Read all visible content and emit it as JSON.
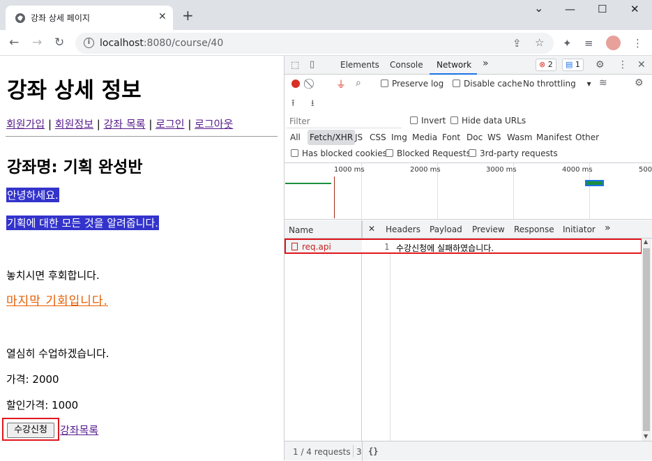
{
  "browser": {
    "tab_title": "강좌 상세 페이지",
    "tab_close": "✕",
    "new_tab": "+",
    "url_host": "localhost",
    "url_rest": ":8080/course/40",
    "win_min": "⌄",
    "win_minimize": "—",
    "win_max": "☐",
    "win_close": "✕"
  },
  "page": {
    "heading": "강좌 상세 정보",
    "nav": [
      "회원가입",
      "회원정보",
      "강좌 목록",
      "로그인",
      "로그아웃"
    ],
    "nav_sep": " | ",
    "course_title": "강좌명: 기획 완성반",
    "highlight1": "안녕하세요.",
    "highlight2": "기획에 대한 모든 것을 알려줍니다.",
    "line1": "놓치시면 후회합니다.",
    "orange_link": "마지막 기회입니다.",
    "line2": "열심히 수업하겠습니다.",
    "price": "가격: 2000",
    "discount_price": "할인가격: 1000",
    "enroll_button": "수강신청",
    "course_list_link": "강좌목록"
  },
  "devtools": {
    "tabs": [
      "Elements",
      "Console",
      "Network"
    ],
    "more_tabs": "»",
    "error_count": "2",
    "message_count": "1",
    "preserve_log": "Preserve log",
    "disable_cache": "Disable cache",
    "throttling": "No throttling",
    "filter_placeholder": "Filter",
    "invert": "Invert",
    "hide_data_urls": "Hide data URLs",
    "type_filters": [
      "All",
      "Fetch/XHR",
      "JS",
      "CSS",
      "Img",
      "Media",
      "Font",
      "Doc",
      "WS",
      "Wasm",
      "Manifest",
      "Other"
    ],
    "active_filter": "Fetch/XHR",
    "has_blocked_cookies": "Has blocked cookies",
    "blocked_requests": "Blocked Requests",
    "third_party": "3rd-party requests",
    "timeline_ticks": [
      "1000 ms",
      "2000 ms",
      "3000 ms",
      "4000 ms",
      "500"
    ],
    "name_header": "Name",
    "detail_tabs": [
      "Headers",
      "Payload",
      "Preview",
      "Response",
      "Initiator"
    ],
    "detail_close": "✕",
    "request_name": "req.api",
    "response_line_number": "1",
    "response_text": "수강신청에 실패하였습니다.",
    "footer_requests": "1 / 4 requests",
    "footer_partial": "3",
    "footer_braces": "{}"
  }
}
